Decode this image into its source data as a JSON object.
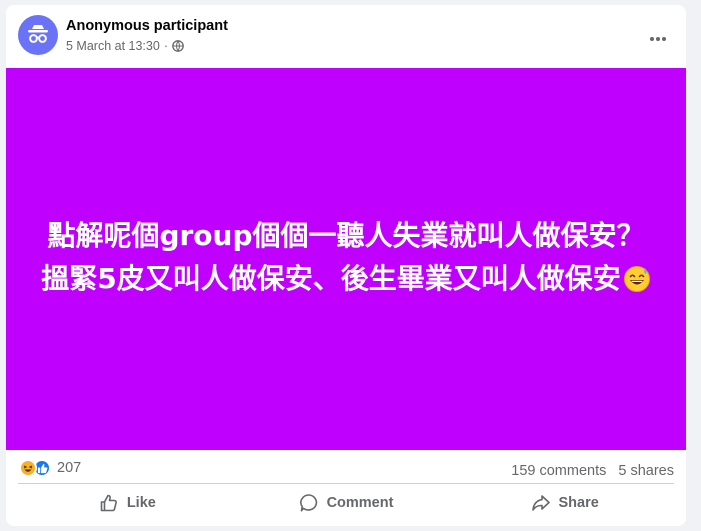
{
  "post": {
    "author": "Anonymous participant",
    "date": "5 March at 13:30",
    "separator": "·",
    "privacy_icon": "globe-icon",
    "text": "點解呢個group個個一聽人失業就叫人做保安？搵緊5皮又叫人做保安、後生畢業又叫人做保安",
    "emoji_icon": "grinning-sweat-emoji",
    "background_color": "#bf00ff",
    "text_color": "#ffffff"
  },
  "stats": {
    "reaction_icons": [
      "haha-reaction-icon",
      "like-reaction-icon"
    ],
    "reaction_count": "207",
    "comments": "159 comments",
    "shares": "5 shares"
  },
  "actions": {
    "like_label": "Like",
    "comment_label": "Comment",
    "share_label": "Share"
  },
  "colors": {
    "avatar": "#6a73f6",
    "like_blue": "#1877f2",
    "haha_yellow": "#f7b125",
    "secondary_text": "#65676b"
  }
}
